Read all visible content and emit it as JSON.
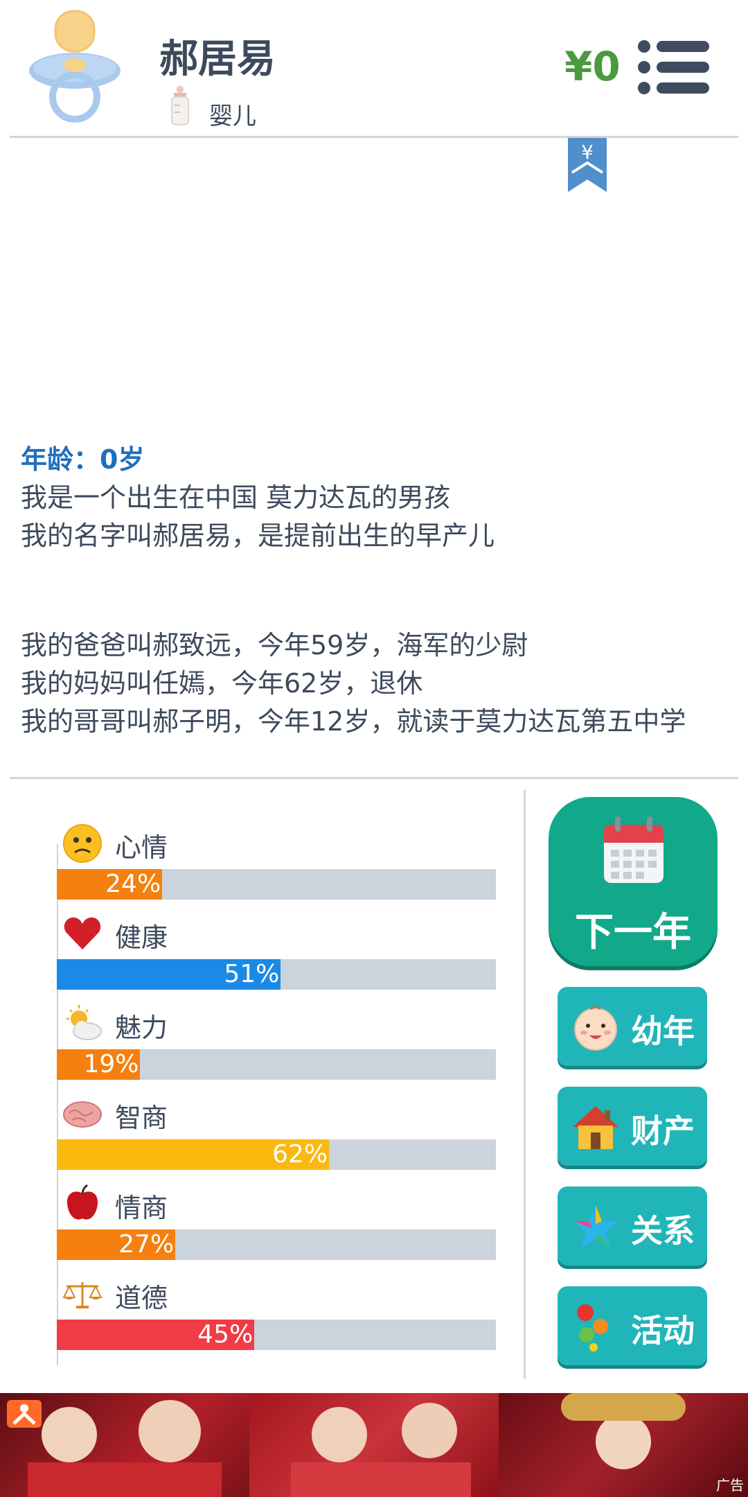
{
  "header": {
    "name": "郝居易",
    "stage": "婴儿",
    "money": "¥0",
    "avatar_icon": "pacifier-icon",
    "stage_icon": "baby-bottle-icon",
    "menu_icon": "list-menu-icon",
    "money_color": "#4a9a3e"
  },
  "story": {
    "age_line": "年龄：0岁",
    "lines_1": [
      "我是一个出生在中国 莫力达瓦的男孩",
      "我的名字叫郝居易，是提前出生的早产儿"
    ],
    "lines_2": [
      "我的爸爸叫郝致远，今年59岁，海军的少尉",
      "我的妈妈叫任嫣，今年62岁，退休",
      "我的哥哥叫郝子明，今年12岁，就读于莫力达瓦第五中学"
    ]
  },
  "stats": [
    {
      "label": "心情",
      "value": 24,
      "text": "24%",
      "color": "#f5800f",
      "icon": "sad-face-icon"
    },
    {
      "label": "健康",
      "value": 51,
      "text": "51%",
      "color": "#1a8ae6",
      "icon": "heart-icon"
    },
    {
      "label": "魅力",
      "value": 19,
      "text": "19%",
      "color": "#f5800f",
      "icon": "sun-cloud-icon"
    },
    {
      "label": "智商",
      "value": 62,
      "text": "62%",
      "color": "#fbb80f",
      "icon": "brain-icon"
    },
    {
      "label": "情商",
      "value": 27,
      "text": "27%",
      "color": "#f5800f",
      "icon": "apple-icon"
    },
    {
      "label": "道德",
      "value": 45,
      "text": "45%",
      "color": "#f03c46",
      "icon": "scales-icon"
    }
  ],
  "buttons": {
    "next_year": "下一年",
    "next_icon": "calendar-icon",
    "childhood": "幼年",
    "childhood_icon": "baby-face-icon",
    "assets": "财产",
    "assets_icon": "house-icon",
    "relations": "关系",
    "relations_icon": "star-icon",
    "activities": "活动",
    "activities_icon": "dots-icon"
  },
  "ad": {
    "label": "广告"
  },
  "bookmark_symbol": "¥"
}
